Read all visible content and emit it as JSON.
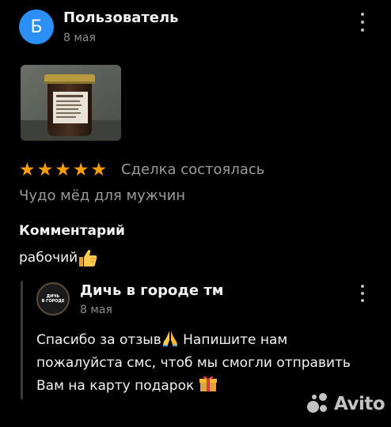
{
  "review": {
    "avatar_letter": "Б",
    "author": "Пользователь",
    "date": "8 мая",
    "rating": 5,
    "stars": [
      "★",
      "★",
      "★",
      "★",
      "★"
    ],
    "deal_status": "Сделка состоялась",
    "title": "Чудо мёд для мужчин",
    "comment_heading": "Комментарий",
    "comment_text": "рабочий"
  },
  "reply": {
    "author": "Дичь в городе тм",
    "logo_line1": "ДИЧЬ",
    "logo_line2": "В ГОРОДЕ",
    "date": "8 мая",
    "text_1": "Спасибо за отзыв",
    "text_2": " Напишите нам пожалуйста смс, чтоб мы смогли отправить Вам на карту подарок "
  },
  "watermark": {
    "brand": "Avito"
  },
  "colors": {
    "accent_avatar": "#2b8ff5",
    "star": "#ff9f00",
    "muted": "#9a9a9a"
  },
  "icons": [
    "kebab-menu-icon",
    "star-icon",
    "thumbs-up-icon",
    "pray-hands-icon",
    "gift-icon",
    "avito-logo-icon"
  ]
}
